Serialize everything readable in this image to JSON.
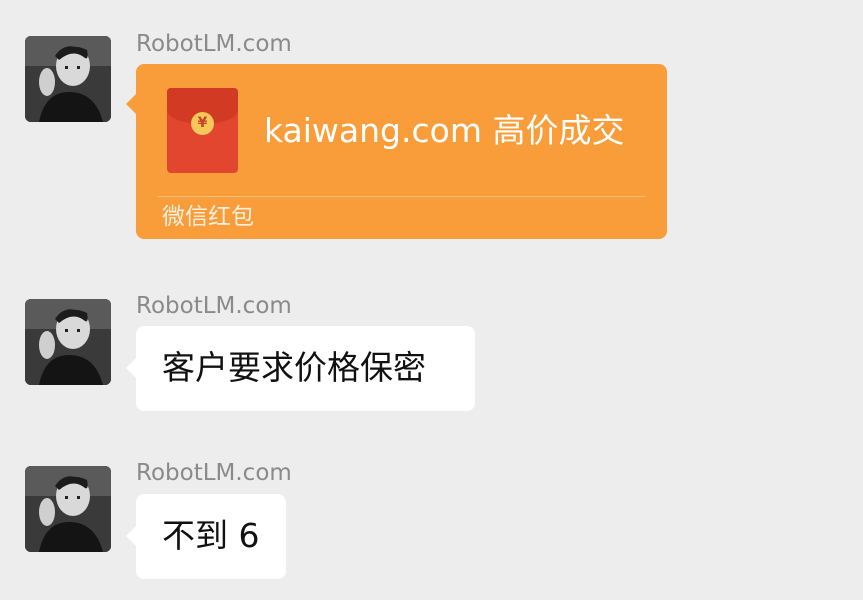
{
  "chat": {
    "messages": [
      {
        "sender": "RobotLM.com",
        "type": "red_packet",
        "red_packet": {
          "title": "kaiwang.com 高价成交",
          "footer": "微信红包",
          "coin_symbol": "¥"
        }
      },
      {
        "sender": "RobotLM.com",
        "type": "text",
        "text": "客户要求价格保密"
      },
      {
        "sender": "RobotLM.com",
        "type": "text",
        "text": "不到 6"
      }
    ]
  },
  "colors": {
    "background": "#ededed",
    "bubble": "#ffffff",
    "red_packet": "#f99d3a",
    "envelope": "#e2462e",
    "sender_text": "#8a8a8a"
  },
  "icons": {
    "avatar": "avatar-photo",
    "red_packet": "red-envelope-icon"
  }
}
